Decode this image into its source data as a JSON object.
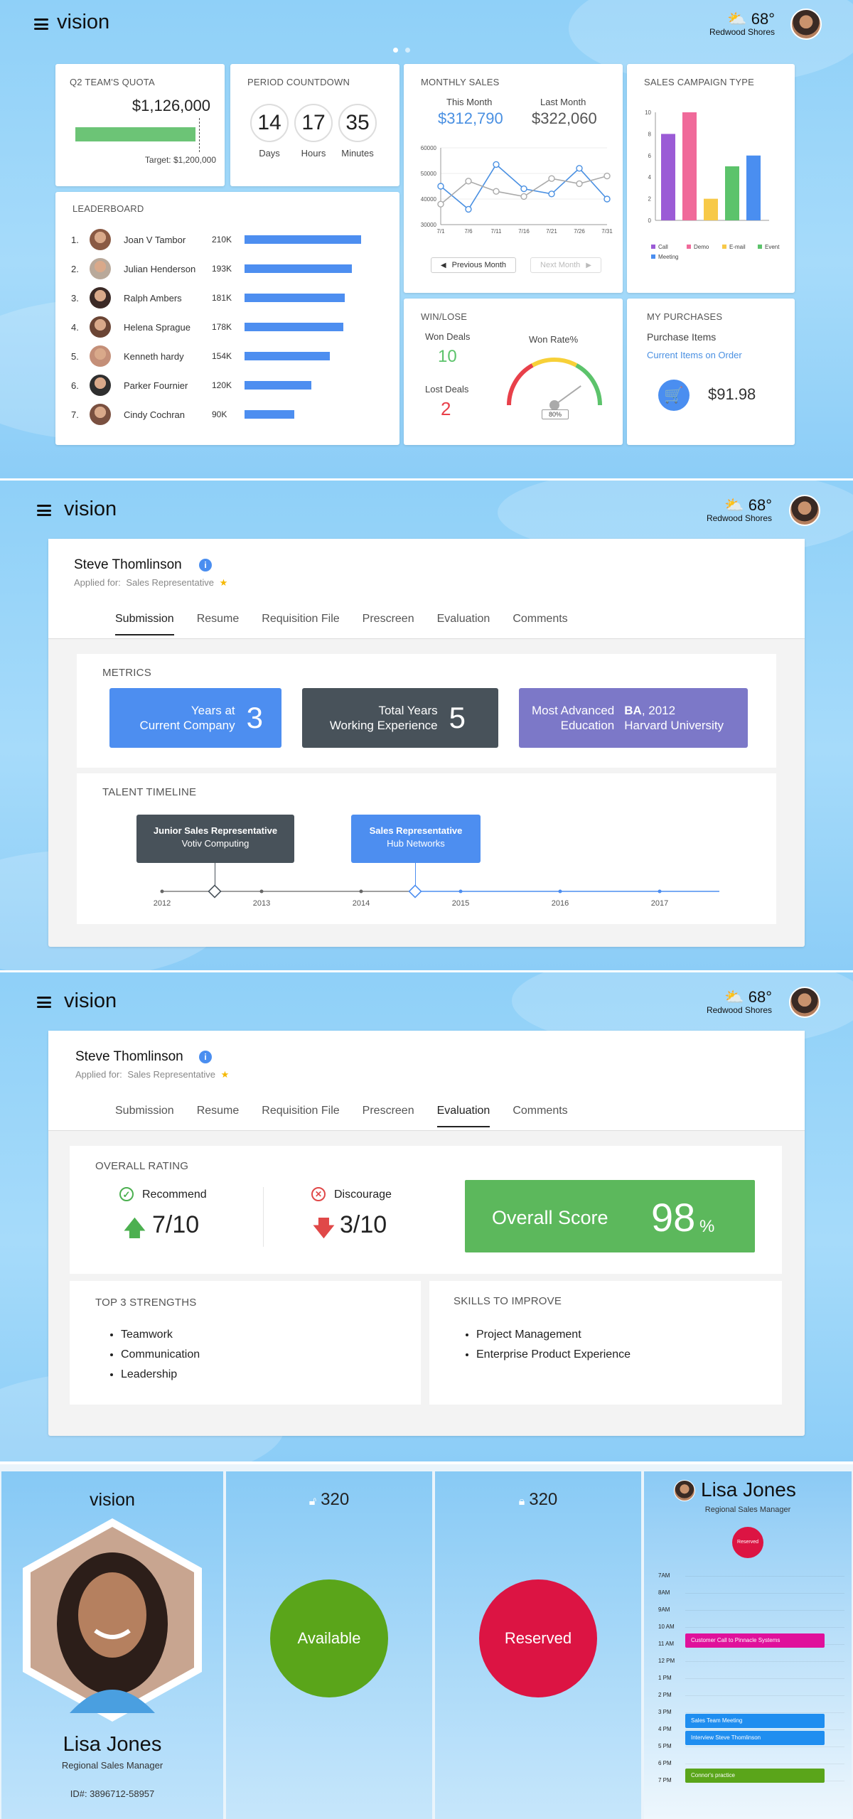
{
  "app": {
    "name": "vision"
  },
  "weather": {
    "temp": "68°",
    "location": "Redwood Shores"
  },
  "dashboard": {
    "quota": {
      "title": "Q2 TEAM'S QUOTA",
      "value": "$1,126,000",
      "target": "Target: $1,200,000",
      "progress": 0.938
    },
    "countdown": {
      "title": "PERIOD COUNTDOWN",
      "days": "14",
      "days_label": "Days",
      "hours": "17",
      "hours_label": "Hours",
      "minutes": "35",
      "minutes_label": "Minutes"
    },
    "monthly_sales": {
      "title": "MONTHLY SALES",
      "this_label": "This Month",
      "this_value": "$312,790",
      "last_label": "Last Month",
      "last_value": "$322,060",
      "prev_button": "Previous Month",
      "next_button": "Next Month"
    },
    "campaign": {
      "title": "SALES CAMPAIGN TYPE"
    },
    "leaderboard": {
      "title": "LEADERBOARD",
      "rows": [
        {
          "rank": "1.",
          "name": "Joan V Tambor",
          "value": "210K",
          "amount": 210
        },
        {
          "rank": "2.",
          "name": "Julian Henderson",
          "value": "193K",
          "amount": 193
        },
        {
          "rank": "3.",
          "name": "Ralph Ambers",
          "value": "181K",
          "amount": 181
        },
        {
          "rank": "4.",
          "name": "Helena Sprague",
          "value": "178K",
          "amount": 178
        },
        {
          "rank": "5.",
          "name": "Kenneth hardy",
          "value": "154K",
          "amount": 154
        },
        {
          "rank": "6.",
          "name": "Parker Fournier",
          "value": "120K",
          "amount": 120
        },
        {
          "rank": "7.",
          "name": "Cindy Cochran",
          "value": "90K",
          "amount": 90
        }
      ]
    },
    "winlose": {
      "title": "WIN/LOSE",
      "won_label": "Won Deals",
      "won_value": "10",
      "lost_label": "Lost Deals",
      "lost_value": "2",
      "rate_label": "Won Rate%",
      "rate_value": "80%",
      "rate": 80
    },
    "purchases": {
      "title": "MY PURCHASES",
      "subtitle": "Purchase Items",
      "link": "Current Items on Order",
      "amount": "$91.98"
    }
  },
  "chart_data": [
    {
      "type": "line",
      "x": [
        "7/1",
        "7/6",
        "7/11",
        "7/16",
        "7/21",
        "7/26",
        "7/31"
      ],
      "yticks": [
        "60000",
        "50000",
        "40000",
        "30000"
      ],
      "ylim": [
        30000,
        60000
      ],
      "series": [
        {
          "values": [
            45000,
            36000,
            53500,
            44000,
            42000,
            52000,
            40000
          ],
          "color": "#4a90e2"
        },
        {
          "values": [
            38000,
            47000,
            43000,
            41000,
            48000,
            46000,
            49000
          ],
          "color": "#aaaaaa"
        }
      ]
    },
    {
      "type": "bar",
      "categories": [
        "Call",
        "Demo",
        "E-mail",
        "Event",
        "Meeting"
      ],
      "values": [
        8,
        10,
        2,
        5,
        6
      ],
      "yticks": [
        "10",
        "8",
        "6",
        "4",
        "2",
        "0"
      ],
      "ylim": [
        0,
        10
      ],
      "colors": [
        "#9b5bd6",
        "#f06a9a",
        "#f7c948",
        "#5cc36b",
        "#4a8ef0"
      ]
    }
  ],
  "candidate": {
    "name": "Steve Thomlinson",
    "applied_label": "Applied for:",
    "applied_role": "Sales Representative",
    "tabs": [
      "Submission",
      "Resume",
      "Requisition File",
      "Prescreen",
      "Evaluation",
      "Comments"
    ]
  },
  "metrics": {
    "title": "METRICS",
    "items": [
      {
        "label1": "Years at",
        "label2": "Current Company",
        "value": "3"
      },
      {
        "label1": "Total Years",
        "label2": "Working Experience",
        "value": "5"
      },
      {
        "label1": "Most Advanced",
        "label2": "Education",
        "value1": "BA",
        "value1b": ", 2012",
        "value2": "Harvard University"
      }
    ]
  },
  "timeline": {
    "title": "TALENT TIMELINE",
    "job1_title": "Junior Sales Representative",
    "job1_company": "Votiv Computing",
    "job2_title": "Sales Representative",
    "job2_company": "Hub Networks",
    "years": [
      "2012",
      "2013",
      "2014",
      "2015",
      "2016",
      "2017"
    ]
  },
  "evaluation": {
    "rating_title": "OVERALL RATING",
    "recommend_label": "Recommend",
    "recommend_value": "7/10",
    "discourage_label": "Discourage",
    "discourage_value": "3/10",
    "score_label": "Overall Score",
    "score_value": "98",
    "score_unit": "%",
    "strengths_title": "TOP 3 STRENGTHS",
    "strengths": [
      "Teamwork",
      "Communication",
      "Leadership"
    ],
    "improve_title": "SKILLS TO IMPROVE",
    "improve": [
      "Project Management",
      "Enterprise Product Experience"
    ]
  },
  "profile": {
    "name": "Lisa Jones",
    "role": "Regional Sales Manager",
    "id": "ID#: 3896712-58957"
  },
  "rooms": [
    {
      "number": "320",
      "status": "Available",
      "color": "#5aa51a"
    },
    {
      "number": "320",
      "status": "Reserved",
      "color": "#dc1443"
    }
  ],
  "schedule": {
    "name": "Lisa Jones",
    "role": "Regional Sales Manager",
    "badge": "Reserved",
    "times": [
      "7AM",
      "8AM",
      "9AM",
      "10 AM",
      "11 AM",
      "12 PM",
      "1 PM",
      "2 PM",
      "3 PM",
      "4 PM",
      "5 PM",
      "6 PM",
      "7 PM"
    ],
    "events": [
      {
        "label": "Customer Call to Pinnacle Systems",
        "color": "#e0119b"
      },
      {
        "label": "Sales Team Meeting",
        "color": "#1f8ef0"
      },
      {
        "label": "Interview Steve Thomlinson",
        "color": "#1f8ef0"
      },
      {
        "label": "Connor's practice",
        "color": "#5aa51a"
      }
    ]
  }
}
